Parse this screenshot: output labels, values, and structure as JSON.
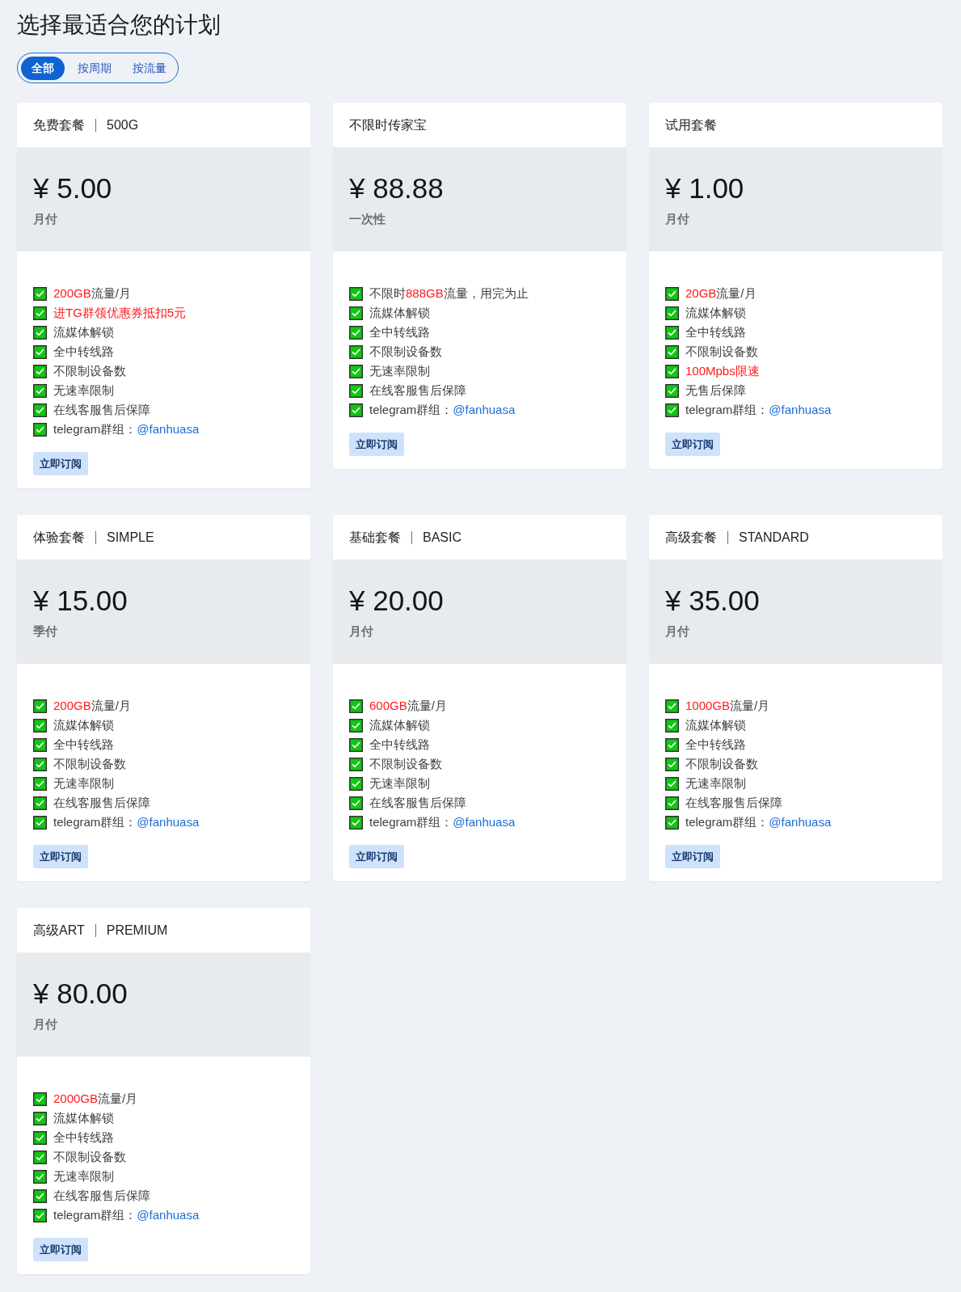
{
  "page_title": "选择最适合您的计划",
  "filter_tabs": [
    {
      "label": "全部",
      "selected": true
    },
    {
      "label": "按周期",
      "selected": false
    },
    {
      "label": "按流量",
      "selected": false
    }
  ],
  "plans": [
    {
      "name": "免费套餐",
      "tier": "500G",
      "price": "¥ 5.00",
      "period": "月付",
      "features": [
        [
          {
            "kind": "highlight",
            "text": "200GB"
          },
          {
            "kind": "plain",
            "text": "流量/月"
          }
        ],
        [
          {
            "kind": "highlight",
            "text": "进TG群领优惠券抵扣5元"
          }
        ],
        [
          {
            "kind": "plain",
            "text": "流媒体解锁"
          }
        ],
        [
          {
            "kind": "plain",
            "text": "全中转线路"
          }
        ],
        [
          {
            "kind": "plain",
            "text": "不限制设备数"
          }
        ],
        [
          {
            "kind": "plain",
            "text": "无速率限制"
          }
        ],
        [
          {
            "kind": "plain",
            "text": "在线客服售后保障"
          }
        ],
        [
          {
            "kind": "plain",
            "text": "telegram群组："
          },
          {
            "kind": "link",
            "text": "@fanhuasa"
          }
        ]
      ],
      "button": "立即订阅"
    },
    {
      "name": "不限时传家宝",
      "price": "¥ 88.88",
      "period": "一次性",
      "features": [
        [
          {
            "kind": "plain",
            "text": "不限时"
          },
          {
            "kind": "highlight",
            "text": "888GB"
          },
          {
            "kind": "plain",
            "text": "流量，用完为止"
          }
        ],
        [
          {
            "kind": "plain",
            "text": "流媒体解锁"
          }
        ],
        [
          {
            "kind": "plain",
            "text": "全中转线路"
          }
        ],
        [
          {
            "kind": "plain",
            "text": "不限制设备数"
          }
        ],
        [
          {
            "kind": "plain",
            "text": "无速率限制"
          }
        ],
        [
          {
            "kind": "plain",
            "text": "在线客服售后保障"
          }
        ],
        [
          {
            "kind": "plain",
            "text": "telegram群组："
          },
          {
            "kind": "link",
            "text": "@fanhuasa"
          }
        ]
      ],
      "button": "立即订阅"
    },
    {
      "name": "试用套餐",
      "price": "¥ 1.00",
      "period": "月付",
      "features": [
        [
          {
            "kind": "highlight",
            "text": "20GB"
          },
          {
            "kind": "plain",
            "text": "流量/月"
          }
        ],
        [
          {
            "kind": "plain",
            "text": "流媒体解锁"
          }
        ],
        [
          {
            "kind": "plain",
            "text": "全中转线路"
          }
        ],
        [
          {
            "kind": "plain",
            "text": "不限制设备数"
          }
        ],
        [
          {
            "kind": "highlight",
            "text": "100Mpbs限速"
          }
        ],
        [
          {
            "kind": "plain",
            "text": "无售后保障"
          }
        ],
        [
          {
            "kind": "plain",
            "text": "telegram群组："
          },
          {
            "kind": "link",
            "text": "@fanhuasa"
          }
        ]
      ],
      "button": "立即订阅"
    },
    {
      "name": "体验套餐",
      "tier": "SIMPLE",
      "price": "¥ 15.00",
      "period": "季付",
      "features": [
        [
          {
            "kind": "highlight",
            "text": "200GB"
          },
          {
            "kind": "plain",
            "text": "流量/月"
          }
        ],
        [
          {
            "kind": "plain",
            "text": "流媒体解锁"
          }
        ],
        [
          {
            "kind": "plain",
            "text": "全中转线路"
          }
        ],
        [
          {
            "kind": "plain",
            "text": "不限制设备数"
          }
        ],
        [
          {
            "kind": "plain",
            "text": "无速率限制"
          }
        ],
        [
          {
            "kind": "plain",
            "text": "在线客服售后保障"
          }
        ],
        [
          {
            "kind": "plain",
            "text": "telegram群组："
          },
          {
            "kind": "link",
            "text": "@fanhuasa"
          }
        ]
      ],
      "button": "立即订阅"
    },
    {
      "name": "基础套餐",
      "tier": "BASIC",
      "price": "¥ 20.00",
      "period": "月付",
      "features": [
        [
          {
            "kind": "highlight",
            "text": "600GB"
          },
          {
            "kind": "plain",
            "text": "流量/月"
          }
        ],
        [
          {
            "kind": "plain",
            "text": "流媒体解锁"
          }
        ],
        [
          {
            "kind": "plain",
            "text": "全中转线路"
          }
        ],
        [
          {
            "kind": "plain",
            "text": "不限制设备数"
          }
        ],
        [
          {
            "kind": "plain",
            "text": "无速率限制"
          }
        ],
        [
          {
            "kind": "plain",
            "text": "在线客服售后保障"
          }
        ],
        [
          {
            "kind": "plain",
            "text": "telegram群组："
          },
          {
            "kind": "link",
            "text": "@fanhuasa"
          }
        ]
      ],
      "button": "立即订阅"
    },
    {
      "name": "高级套餐",
      "tier": "STANDARD",
      "price": "¥ 35.00",
      "period": "月付",
      "features": [
        [
          {
            "kind": "highlight",
            "text": "1000GB"
          },
          {
            "kind": "plain",
            "text": "流量/月"
          }
        ],
        [
          {
            "kind": "plain",
            "text": "流媒体解锁"
          }
        ],
        [
          {
            "kind": "plain",
            "text": "全中转线路"
          }
        ],
        [
          {
            "kind": "plain",
            "text": "不限制设备数"
          }
        ],
        [
          {
            "kind": "plain",
            "text": "无速率限制"
          }
        ],
        [
          {
            "kind": "plain",
            "text": "在线客服售后保障"
          }
        ],
        [
          {
            "kind": "plain",
            "text": "telegram群组："
          },
          {
            "kind": "link",
            "text": "@fanhuasa"
          }
        ]
      ],
      "button": "立即订阅"
    },
    {
      "name": "高级ART",
      "tier": "PREMIUM",
      "price": "¥ 80.00",
      "period": "月付",
      "features": [
        [
          {
            "kind": "highlight",
            "text": "2000GB"
          },
          {
            "kind": "plain",
            "text": "流量/月"
          }
        ],
        [
          {
            "kind": "plain",
            "text": "流媒体解锁"
          }
        ],
        [
          {
            "kind": "plain",
            "text": "全中转线路"
          }
        ],
        [
          {
            "kind": "plain",
            "text": "不限制设备数"
          }
        ],
        [
          {
            "kind": "plain",
            "text": "无速率限制"
          }
        ],
        [
          {
            "kind": "plain",
            "text": "在线客服售后保障"
          }
        ],
        [
          {
            "kind": "plain",
            "text": "telegram群组："
          },
          {
            "kind": "link",
            "text": "@fanhuasa"
          }
        ]
      ],
      "button": "立即订阅"
    }
  ]
}
